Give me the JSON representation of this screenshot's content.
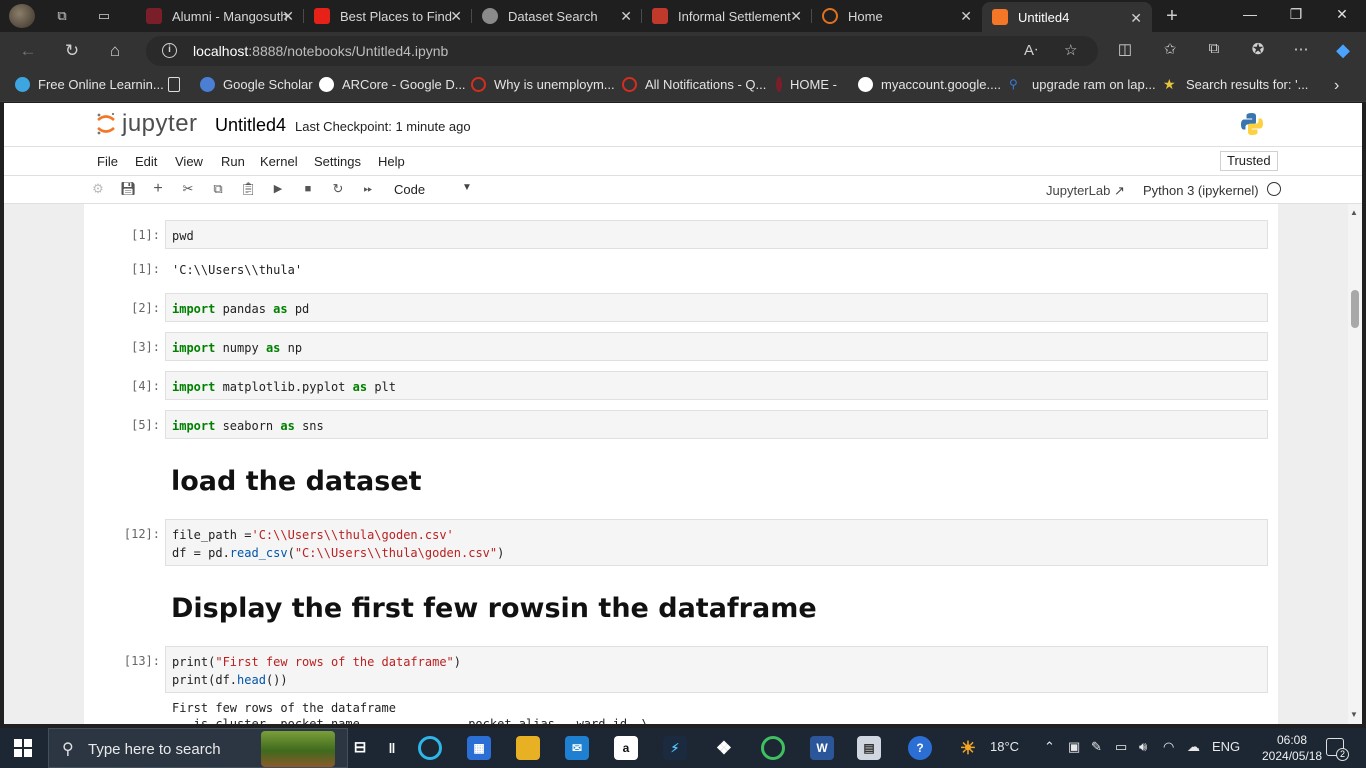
{
  "browser": {
    "tabs": [
      {
        "label": "Alumni - Mangosuthu",
        "favicon_color": "#7a1f2a"
      },
      {
        "label": "Best Places to Find D",
        "favicon_color": "#e62117"
      },
      {
        "label": "Dataset Search",
        "favicon_color": "#8a8a8a"
      },
      {
        "label": "Informal Settlement",
        "favicon_color": "#c0392b"
      },
      {
        "label": "Home",
        "favicon_color": "#e07020"
      },
      {
        "label": "Untitled4",
        "favicon_color": "#f37726"
      }
    ],
    "address": {
      "host": "localhost",
      "rest": ":8888/notebooks/Untitled4.ipynb"
    },
    "bookmarks": [
      {
        "label": "Free Online Learnin...",
        "color": "#3da5e0"
      },
      {
        "label": "",
        "color": "#ffffff"
      },
      {
        "label": "Google Scholar",
        "color": "#4a7fd4"
      },
      {
        "label": "ARCore - Google D...",
        "color": "#ffffff"
      },
      {
        "label": "Why is unemploym...",
        "color": "#d62d20"
      },
      {
        "label": "All Notifications - Q...",
        "color": "#d62d20"
      },
      {
        "label": "HOME -",
        "color": "#7a1f2a"
      },
      {
        "label": "myaccount.google....",
        "color": "#ffffff"
      },
      {
        "label": "upgrade ram on lap...",
        "color": "#3a7bd5"
      },
      {
        "label": "Search results for: '...",
        "color": "#e8c23a"
      }
    ]
  },
  "jupyter": {
    "logo_text": "jupyter",
    "notebook_title": "Untitled4",
    "checkpoint": "Last Checkpoint: 1 minute ago",
    "menu": [
      "File",
      "Edit",
      "View",
      "Run",
      "Kernel",
      "Settings",
      "Help"
    ],
    "trusted": "Trusted",
    "cell_type": "Code",
    "jupyterlab_link": "JupyterLab",
    "kernel": "Python 3 (ipykernel)"
  },
  "cells": {
    "c1_prompt": "[1]:",
    "c1_code": "pwd",
    "c1_out_prompt": "[1]:",
    "c1_output": "'C:\\\\Users\\\\thula'",
    "c2_prompt": "[2]:",
    "c3_prompt": "[3]:",
    "c4_prompt": "[4]:",
    "c5_prompt": "[5]:",
    "heading1": "load the dataset",
    "c12_prompt": "[12]:",
    "heading2": "Display the first few rowsin the dataframe",
    "c13_prompt": "[13]:",
    "c13_output_line1": "First few rows of the dataframe",
    "c13_output_line2": "   is_cluster  pocket_name               pocket_alias   ward_id  \\"
  },
  "taskbar": {
    "search_placeholder": "Type here to search",
    "weather": "18°C",
    "language": "ENG",
    "time": "06:08",
    "date": "2024/05/18",
    "notification_count": "2"
  }
}
